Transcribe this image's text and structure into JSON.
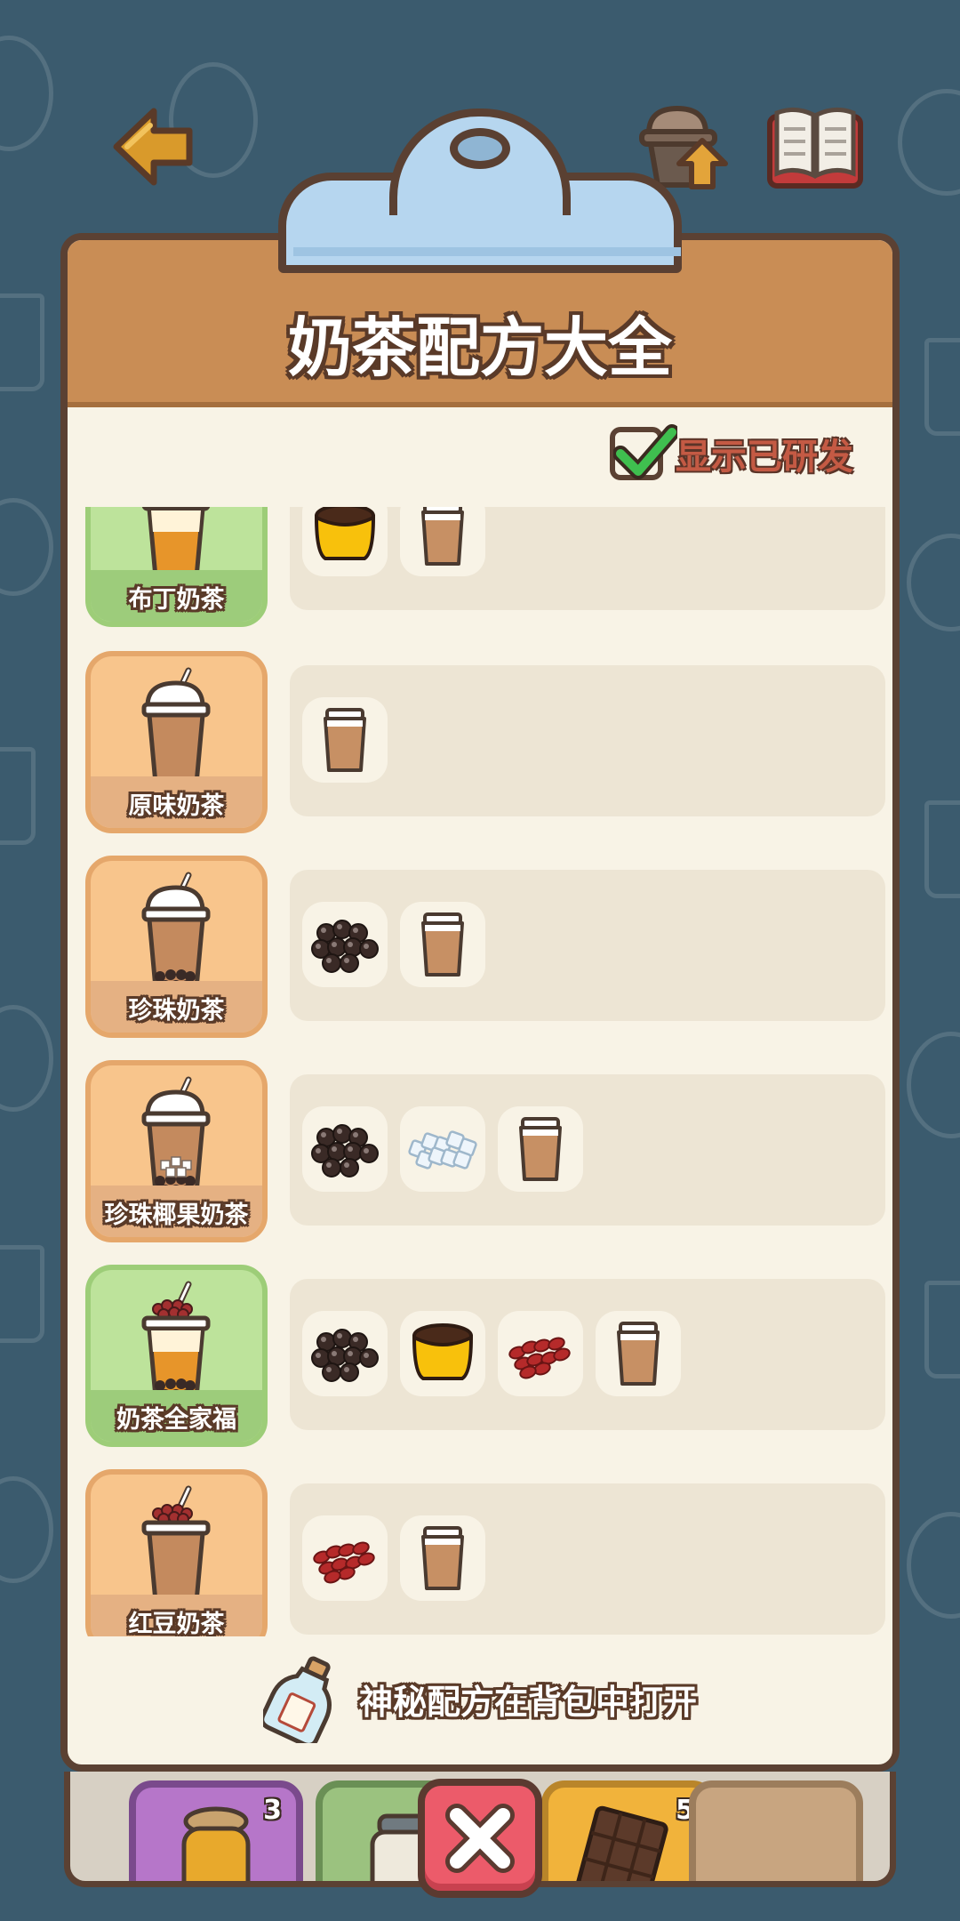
{
  "header": {
    "title": "奶茶配方大全",
    "toggle_label": "显示已研发",
    "toggle_checked": true
  },
  "top_icons": [
    "back-arrow-icon",
    "upgrade-icon",
    "recipe-book-icon"
  ],
  "recipes": [
    {
      "name": "布丁奶茶",
      "theme": "green",
      "ingredients": [
        "pudding",
        "milk-tea-cup"
      ]
    },
    {
      "name": "原味奶茶",
      "theme": "orange",
      "ingredients": [
        "milk-tea-cup"
      ]
    },
    {
      "name": "珍珠奶茶",
      "theme": "orange",
      "ingredients": [
        "pearls",
        "milk-tea-cup"
      ]
    },
    {
      "name": "珍珠椰果奶茶",
      "theme": "orange",
      "ingredients": [
        "pearls",
        "coconut-jelly",
        "milk-tea-cup"
      ]
    },
    {
      "name": "奶茶全家福",
      "theme": "green",
      "ingredients": [
        "pearls",
        "pudding",
        "red-beans",
        "milk-tea-cup"
      ]
    },
    {
      "name": "红豆奶茶",
      "theme": "orange",
      "ingredients": [
        "red-beans",
        "milk-tea-cup"
      ]
    }
  ],
  "hint": {
    "text": "神秘配方在背包中打开",
    "icon": "bottle-icon"
  },
  "backpack": [
    {
      "item": "honey-jar",
      "count": "3"
    },
    {
      "item": "milk-jar",
      "count": ""
    },
    {
      "item": "chocolate",
      "count": "5"
    },
    {
      "item": "empty",
      "count": ""
    }
  ],
  "colors": {
    "background": "#3b5b6e",
    "panel": "#f8f3e6",
    "header": "#c98d55",
    "close": "#ec5b6a"
  }
}
